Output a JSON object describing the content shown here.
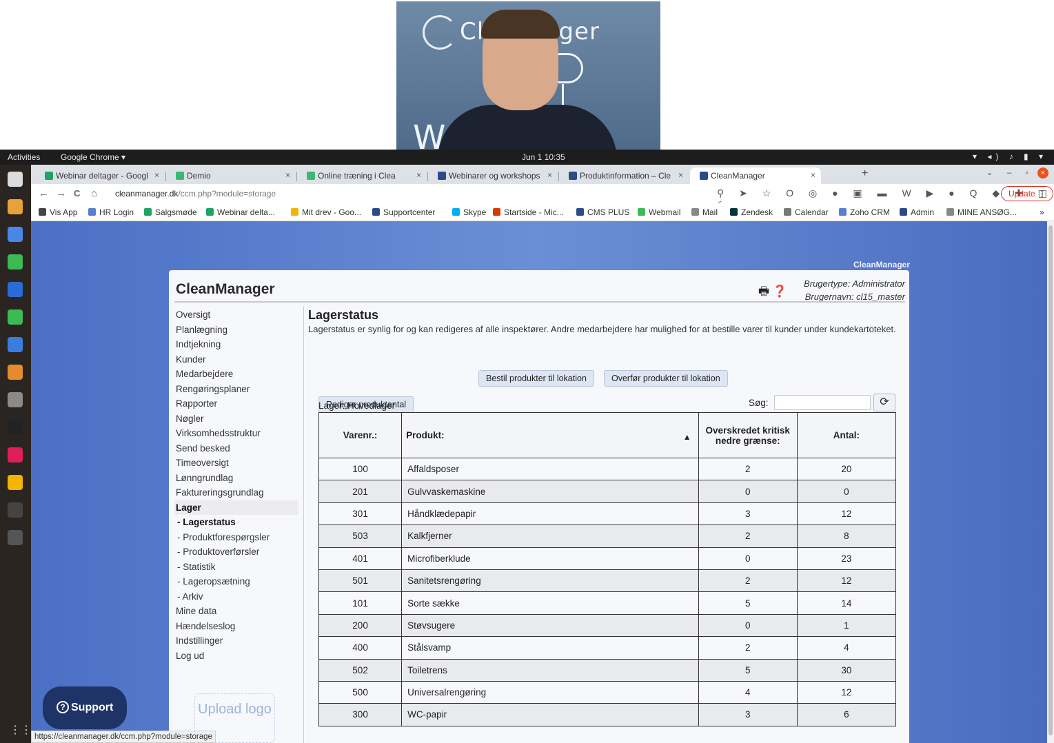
{
  "webcam": {
    "brand_text": "Cl   Manager",
    "w_letter": "W"
  },
  "topbar": {
    "activities": "Activities",
    "app_menu": "Google Chrome ▾",
    "clock": "Jun 1  10:35",
    "tray": "▾ ◂) ♪ ▮ ▾"
  },
  "tabs": [
    {
      "label": "Webinar deltager - Googl",
      "color": "#1fa463"
    },
    {
      "label": "Demio",
      "color": "#3bb873"
    },
    {
      "label": "Online træning i Clea",
      "color": "#3bb873"
    },
    {
      "label": "Webinarer og workshops",
      "color": "#2a4a8a"
    },
    {
      "label": "Produktinformation – Cle",
      "color": "#2a4a8a"
    },
    {
      "label": "CleanManager",
      "color": "#2a4a8a"
    }
  ],
  "tab_close": "×",
  "new_tab": "+",
  "window_controls": {
    "chevron": "⌄",
    "minimize": "–",
    "maximize": "▫",
    "close": "×"
  },
  "toolbar": {
    "back": "←",
    "forward": "→",
    "reload": "C",
    "home": "⌂",
    "url_host": "cleanmanager.dk",
    "url_path": "/ccm.php?module=storage",
    "ext_icons": "⚲ ➤ ☆ O ◎ ● ▣ ▬ W ▶ ● Q ◆ ✚ ◫ ☾",
    "update_label": "Update ⋮"
  },
  "bookmarks": [
    {
      "label": "Vis App",
      "color": "#444"
    },
    {
      "label": "HR Login",
      "color": "#5a7fd0"
    },
    {
      "label": "Salgsmøde",
      "color": "#1fa463"
    },
    {
      "label": "Webinar delta...",
      "color": "#1fa463"
    },
    {
      "label": "Mit drev - Goo...",
      "color": "#f4b400"
    },
    {
      "label": "Supportcenter",
      "color": "#2a4a8a"
    },
    {
      "label": "Skype",
      "color": "#00aff0"
    },
    {
      "label": "Startside - Mic...",
      "color": "#d83b01"
    },
    {
      "label": "CMS PLUS",
      "color": "#2a4a8a"
    },
    {
      "label": "Webmail",
      "color": "#3cba54"
    },
    {
      "label": "Mail",
      "color": "#888"
    },
    {
      "label": "Zendesk",
      "color": "#03363d"
    },
    {
      "label": "Calendar",
      "color": "#777"
    },
    {
      "label": "Zoho CRM",
      "color": "#5a7fd0"
    },
    {
      "label": "Admin",
      "color": "#2a4a8a"
    },
    {
      "label": "MINE ANSØG...",
      "color": "#888"
    }
  ],
  "bookmarks_more": "»",
  "page": {
    "corner_brand": "CleanManager",
    "app_title": "CleanManager",
    "header_icons": "🖶 ❓",
    "user_type": "Brugertype: Administrator",
    "user_name": "Brugernavn: cl15_master"
  },
  "sidebar": {
    "items": [
      "Oversigt",
      "Planlægning",
      "Indtjekning",
      "Kunder",
      "Medarbejdere",
      "Rengøringsplaner",
      "Rapporter",
      "Nøgler",
      "Virksomhedsstruktur",
      "Send besked",
      "Timeoversigt",
      "Lønngrundlag",
      "Faktureringsgrundlag"
    ],
    "active_item": "Lager",
    "sub_items": [
      "- Lagerstatus",
      "- Produktforespørgsler",
      "- Produktoverførsler",
      "- Statistik",
      "- Lageropsætning",
      "- Arkiv"
    ],
    "after_items": [
      "Mine data",
      "Hændelseslog",
      "Indstillinger",
      "Log ud"
    ],
    "upload_logo": "Upload logo"
  },
  "content": {
    "title": "Lagerstatus",
    "description": "Lagerstatus er synlig for og kan redigeres af alle inspektører. Andre medarbejdere har mulighed for at bestille varer til kunder under kundekartoteket.",
    "btn_order": "Bestil produkter til lokation",
    "btn_transfer": "Overfør produkter til lokation",
    "btn_edit_qty": "Rediger produktantal",
    "lager_label": "Lager:  Hovedlager",
    "search_label": "Søg:",
    "search_value": "",
    "refresh_icon": "⟳",
    "sort_arrow": "▲"
  },
  "table": {
    "headers": {
      "no": "Varenr.:",
      "product": "Produkt:",
      "critical": "Overskredet kritisk nedre grænse:",
      "qty": "Antal:"
    },
    "rows": [
      [
        "100",
        "Affaldsposer",
        "2",
        "20"
      ],
      [
        "201",
        "Gulvvaskemaskine",
        "0",
        "0"
      ],
      [
        "301",
        "Håndklædepapir",
        "3",
        "12"
      ],
      [
        "503",
        "Kalkfjerner",
        "2",
        "8"
      ],
      [
        "401",
        "Microfiberklude",
        "0",
        "23"
      ],
      [
        "501",
        "Sanitetsrengøring",
        "2",
        "12"
      ],
      [
        "101",
        "Sorte sække",
        "5",
        "14"
      ],
      [
        "200",
        "Støvsugere",
        "0",
        "1"
      ],
      [
        "400",
        "Stålsvamp",
        "2",
        "4"
      ],
      [
        "502",
        "Toiletrens",
        "5",
        "30"
      ],
      [
        "500",
        "Universalrengøring",
        "4",
        "12"
      ],
      [
        "300",
        "WC-papir",
        "3",
        "6"
      ]
    ]
  },
  "support": {
    "label": "Support",
    "icon": "?"
  },
  "statusbar": "https://cleanmanager.dk/ccm.php?module=storage",
  "dock_colors": [
    "#dcdcdc",
    "#e8a23a",
    "#4a86e8",
    "#3cba54",
    "#2b6cd4",
    "#3cba54",
    "#3b7ddd",
    "#e68a2e",
    "#8a8a8a",
    "#222",
    "#e01e5a",
    "#f4b400",
    "#444",
    "#555"
  ]
}
